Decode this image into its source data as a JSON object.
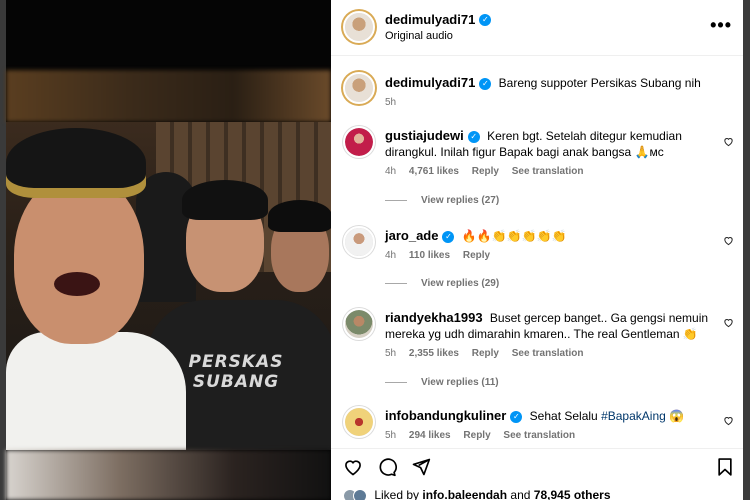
{
  "post": {
    "author": "dedimulyadi71",
    "audio": "Original audio",
    "more_icon": "more-horizontal-icon"
  },
  "media": {
    "shirt_text_line1": "PERSKAS",
    "shirt_text_line2": "SUBANG"
  },
  "caption": {
    "author": "dedimulyadi71",
    "text": "Bareng suppoter Persikas Subang nih",
    "time": "5h"
  },
  "comments": [
    {
      "author": "gustiajudewi",
      "verified": true,
      "text": "Keren bgt. Setelah ditegur kemudian dirangkul. Inilah figur Bapak bagi anak bangsa 🙏ᴍᴄ",
      "time": "4h",
      "likes": "4,761 likes",
      "reply": "Reply",
      "translate": "See translation",
      "view_replies": "View replies (27)"
    },
    {
      "author": "jaro_ade",
      "verified": true,
      "text": "🔥🔥👏👏👏👏👏",
      "time": "4h",
      "likes": "110 likes",
      "reply": "Reply",
      "view_replies": "View replies (29)"
    },
    {
      "author": "riandyekha1993",
      "verified": false,
      "text": "Buset gercep banget.. Ga gengsi nemuin mereka yg udh dimarahin kmaren.. The real Gentleman 👏",
      "time": "5h",
      "likes": "2,355 likes",
      "reply": "Reply",
      "translate": "See translation",
      "view_replies": "View replies (11)"
    },
    {
      "author": "infobandungkuliner",
      "verified": true,
      "text_prefix": "Sehat Selalu",
      "hashtag": "#BapakAing",
      "emoji": "😱",
      "time": "5h",
      "likes": "294 likes",
      "reply": "Reply",
      "translate": "See translation"
    }
  ],
  "footer": {
    "liked_by_prefix": "Liked by",
    "liked_by_user": "info.baleendah",
    "and": "and",
    "others": "78,945 others"
  },
  "colors": {
    "verified": "#0095f6",
    "meta_text": "#737373",
    "hashtag": "#00376b",
    "story_ring": "#d9aa55"
  },
  "icons": [
    "heart-icon",
    "comment-icon",
    "share-icon",
    "bookmark-icon",
    "more-horizontal-icon"
  ]
}
